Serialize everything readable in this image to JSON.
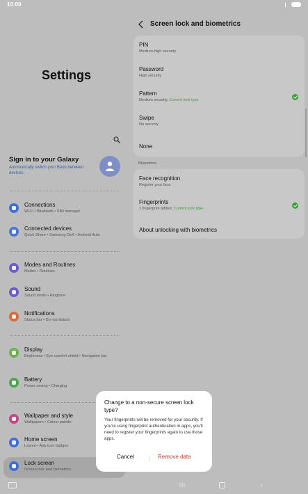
{
  "status_bar": {
    "time": "10:00"
  },
  "left_pane": {
    "title": "Settings",
    "account": {
      "title": "Sign in to your Galaxy",
      "subtitle": "Automatically switch your Buds between devices."
    },
    "items": [
      {
        "title": "Connections",
        "subtitle": "Wi-Fi • Bluetooth • SIM manager",
        "color": "#3f6fdc"
      },
      {
        "title": "Connected devices",
        "subtitle": "Quick Share • Samsung DeX • Android Auto",
        "color": "#4a76d8"
      },
      {
        "title": "Modes and Routines",
        "subtitle": "Modes • Routines",
        "color": "#6b5bd0"
      },
      {
        "title": "Sound",
        "subtitle": "Sound mode • Ringtone",
        "color": "#6a5bcf"
      },
      {
        "title": "Notifications",
        "subtitle": "Status bar • Do not disturb",
        "color": "#d96a3a"
      },
      {
        "title": "Display",
        "subtitle": "Brightness • Eye comfort shield • Navigation bar",
        "color": "#6ab04c"
      },
      {
        "title": "Battery",
        "subtitle": "Power saving • Charging",
        "color": "#4ca64c"
      },
      {
        "title": "Wallpaper and style",
        "subtitle": "Wallpapers • Colour palette",
        "color": "#c04a88"
      },
      {
        "title": "Home screen",
        "subtitle": "Layout • App icon badges",
        "color": "#3f6fdc"
      },
      {
        "title": "Lock screen",
        "subtitle": "Screen lock and biometrics",
        "color": "#3f6fdc"
      }
    ]
  },
  "right_pane": {
    "header": "Screen lock and biometrics",
    "lock_types": [
      {
        "title": "PIN",
        "subtitle": "Medium-high security",
        "current": ""
      },
      {
        "title": "Password",
        "subtitle": "High security",
        "current": ""
      },
      {
        "title": "Pattern",
        "subtitle": "Medium security, ",
        "current": "Current lock type"
      },
      {
        "title": "Swipe",
        "subtitle": "No security",
        "current": ""
      },
      {
        "title": "None",
        "subtitle": "",
        "current": ""
      }
    ],
    "biometrics_label": "Biometrics",
    "biometrics": [
      {
        "title": "Face recognition",
        "subtitle": "Register your face.",
        "current": ""
      },
      {
        "title": "Fingerprints",
        "subtitle": "1 fingerprint added, ",
        "current": "Current lock type"
      },
      {
        "title": "About unlocking with biometrics",
        "subtitle": "",
        "current": ""
      }
    ]
  },
  "dialog": {
    "title": "Change to a non-secure screen lock type?",
    "body": "Your fingerprints will be removed for your security. If you're using fingerprint authentication in apps, you'll need to register your fingerprints again to use those apps.",
    "cancel": "Cancel",
    "confirm": "Remove data"
  },
  "colors": {
    "check": "#3aa13a",
    "current_text": "#3c9a3c",
    "destructive": "#d33a2a",
    "account_link": "#2f5fb0"
  }
}
